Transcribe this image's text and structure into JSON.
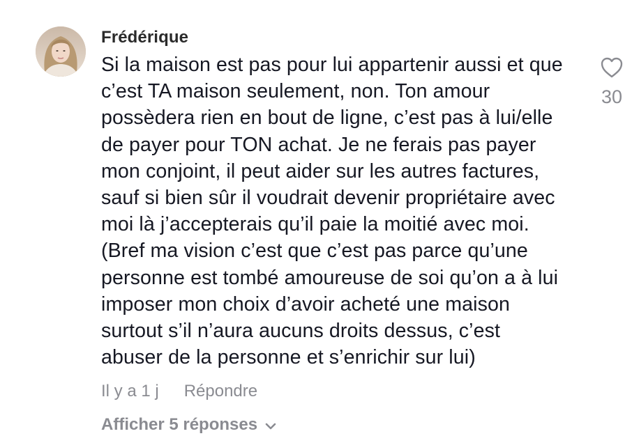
{
  "comment": {
    "author": "Frédérique",
    "text_lines": [
      "Si la maison est pas pour lui appartenir aussi et que",
      "c’est TA maison seulement, non. Ton amour",
      "possèdera rien en bout de ligne, c’est pas à lui/elle",
      "de payer pour TON achat. Je ne ferais pas payer",
      "mon conjoint, il peut aider sur les autres factures,",
      "sauf si bien sûr il voudrait devenir propriétaire avec",
      "moi là j’accepterais qu’il paie la moitié avec moi.",
      "(Bref ma vision c’est que c’est pas parce qu’une",
      "personne est tombé amoureuse de soi qu’on a à lui",
      "imposer mon choix d’avoir acheté une maison",
      "surtout s’il n’aura aucuns droits dessus, c’est",
      "abuser de la personne et s’enrichir sur lui)"
    ],
    "timestamp": "Il y a 1 j",
    "reply_label": "Répondre",
    "view_replies_label": "Afficher 5 réponses",
    "like_count": "30",
    "icons": {
      "like": "heart-outline-icon",
      "expand": "chevron-down-icon",
      "avatar": "user-avatar"
    },
    "colors": {
      "text": "#161823",
      "secondary": "#8a8b91",
      "author": "#2a2a2a"
    }
  }
}
